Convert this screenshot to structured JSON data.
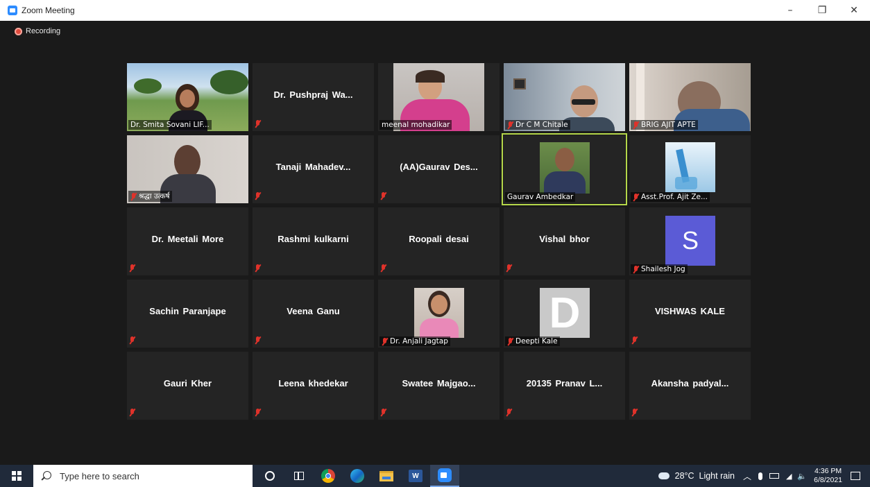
{
  "window": {
    "title": "Zoom Meeting",
    "minimize": "–",
    "maximize": "❐",
    "close": "✕"
  },
  "recording": {
    "label": "Recording"
  },
  "participants": [
    {
      "name": "Dr. Smita Sovani LIF...",
      "muted": false
    },
    {
      "name": "Dr. Pushpraj Wa...",
      "muted": true
    },
    {
      "name": "meenal mohadikar",
      "muted": false
    },
    {
      "name": "Dr C M Chitale",
      "muted": true
    },
    {
      "name": "BRIG AJIT APTE",
      "muted": true
    },
    {
      "name": "श्रद्धा उत्कर्ष",
      "muted": true
    },
    {
      "name": "Tanaji Mahadev...",
      "muted": true
    },
    {
      "name": "(AA)Gaurav Des...",
      "muted": true
    },
    {
      "name": "Gaurav Ambedkar",
      "muted": false
    },
    {
      "name": "Asst.Prof. Ajit Ze...",
      "muted": true
    },
    {
      "name": "Dr. Meetali More",
      "muted": true
    },
    {
      "name": "Rashmi kulkarni",
      "muted": true
    },
    {
      "name": "Roopali desai",
      "muted": true
    },
    {
      "name": "Vishal bhor",
      "muted": true
    },
    {
      "name": "Shailesh Jog",
      "muted": true,
      "avatar_letter": "S"
    },
    {
      "name": "Sachin Paranjape",
      "muted": true
    },
    {
      "name": "Veena Ganu",
      "muted": true
    },
    {
      "name": "Dr. Anjali Jagtap",
      "muted": true
    },
    {
      "name": "Deepti Kale",
      "muted": true,
      "avatar_letter": "D"
    },
    {
      "name": "VISHWAS KALE",
      "muted": true
    },
    {
      "name": "Gauri Kher",
      "muted": true
    },
    {
      "name": "Leena khedekar",
      "muted": true
    },
    {
      "name": "Swatee Majgao...",
      "muted": true
    },
    {
      "name": "20135 Pranav L...",
      "muted": true
    },
    {
      "name": "Akansha padyal...",
      "muted": true
    }
  ],
  "active_speaker": "Gaurav Ambedkar",
  "taskbar": {
    "search_placeholder": "Type here to search",
    "weather": "28°C  Light rain",
    "time": "4:36 PM",
    "date": "6/8/2021"
  },
  "colors": {
    "accent": "#2d8cff",
    "active_border": "#b5d74a",
    "muted_red": "#e0322a",
    "avatar_s": "#5b5bd6"
  }
}
